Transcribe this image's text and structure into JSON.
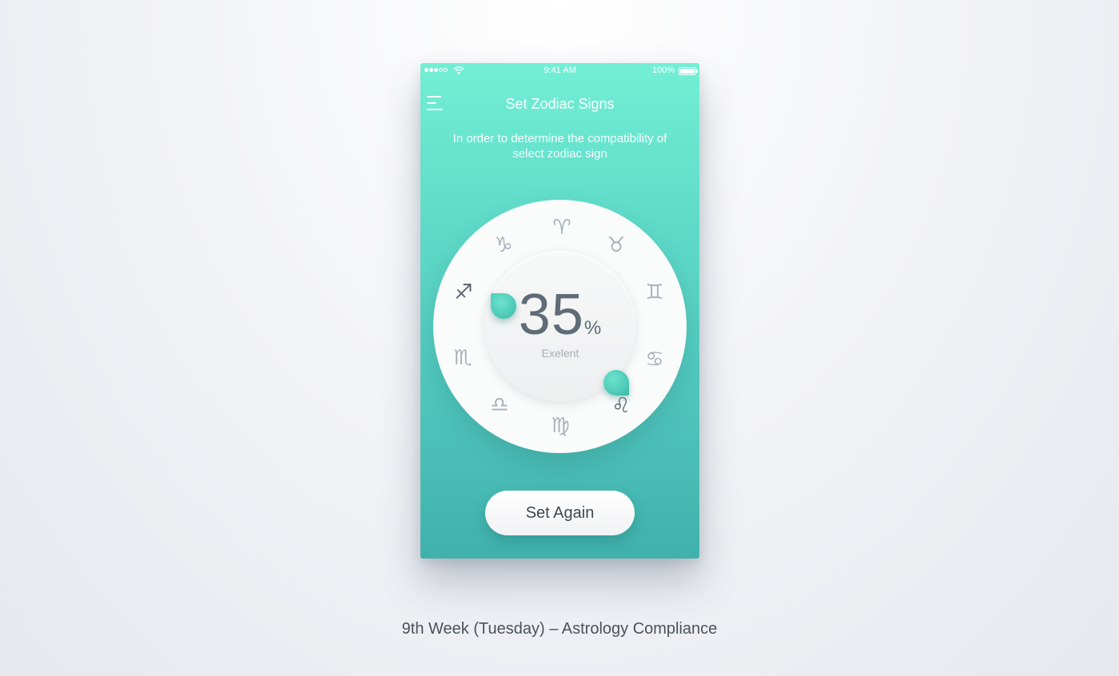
{
  "status_bar": {
    "time": "9:41 AM",
    "battery": "100%",
    "signal_bars": 3,
    "signal_total": 5
  },
  "header": {
    "title": "Set Zodiac Signs",
    "menu_icon": "hamburger-menu-icon"
  },
  "subtitle": "In order to determine the compatibility of select zodiac sign",
  "dial": {
    "percent_value": "35",
    "percent_symbol": "%",
    "rating_label": "Exelent",
    "signs": [
      {
        "key": "aries",
        "glyph": "♈",
        "selected": false
      },
      {
        "key": "taurus",
        "glyph": "♉",
        "selected": false
      },
      {
        "key": "gemini",
        "glyph": "♊",
        "selected": false
      },
      {
        "key": "cancer",
        "glyph": "♋",
        "selected": false
      },
      {
        "key": "leo",
        "glyph": "♌",
        "selected": true
      },
      {
        "key": "virgo",
        "glyph": "♍",
        "selected": false
      },
      {
        "key": "libra",
        "glyph": "♎",
        "selected": false
      },
      {
        "key": "scorpio",
        "glyph": "♏",
        "selected": false
      },
      {
        "key": "sagittarius",
        "glyph": "♐",
        "selected": true
      },
      {
        "key": "capricorn",
        "glyph": "♑",
        "selected": false
      }
    ]
  },
  "actions": {
    "set_again_label": "Set Again"
  },
  "caption": "9th Week (Tuesday) – Astrology Compliance",
  "colors": {
    "accent_top": "#72efd4",
    "accent_bottom": "#40b1ad",
    "handle": "#49c6b4",
    "sign_inactive": "#a9b3bc",
    "sign_active": "#5c6670"
  }
}
